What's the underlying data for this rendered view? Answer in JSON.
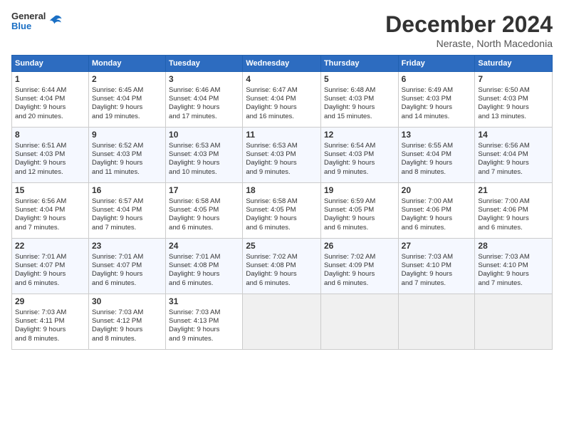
{
  "logo": {
    "general": "General",
    "blue": "Blue"
  },
  "header": {
    "month": "December 2024",
    "location": "Neraste, North Macedonia"
  },
  "weekdays": [
    "Sunday",
    "Monday",
    "Tuesday",
    "Wednesday",
    "Thursday",
    "Friday",
    "Saturday"
  ],
  "weeks": [
    [
      {
        "day": "1",
        "lines": [
          "Sunrise: 6:44 AM",
          "Sunset: 4:04 PM",
          "Daylight: 9 hours",
          "and 20 minutes."
        ]
      },
      {
        "day": "2",
        "lines": [
          "Sunrise: 6:45 AM",
          "Sunset: 4:04 PM",
          "Daylight: 9 hours",
          "and 19 minutes."
        ]
      },
      {
        "day": "3",
        "lines": [
          "Sunrise: 6:46 AM",
          "Sunset: 4:04 PM",
          "Daylight: 9 hours",
          "and 17 minutes."
        ]
      },
      {
        "day": "4",
        "lines": [
          "Sunrise: 6:47 AM",
          "Sunset: 4:04 PM",
          "Daylight: 9 hours",
          "and 16 minutes."
        ]
      },
      {
        "day": "5",
        "lines": [
          "Sunrise: 6:48 AM",
          "Sunset: 4:03 PM",
          "Daylight: 9 hours",
          "and 15 minutes."
        ]
      },
      {
        "day": "6",
        "lines": [
          "Sunrise: 6:49 AM",
          "Sunset: 4:03 PM",
          "Daylight: 9 hours",
          "and 14 minutes."
        ]
      },
      {
        "day": "7",
        "lines": [
          "Sunrise: 6:50 AM",
          "Sunset: 4:03 PM",
          "Daylight: 9 hours",
          "and 13 minutes."
        ]
      }
    ],
    [
      {
        "day": "8",
        "lines": [
          "Sunrise: 6:51 AM",
          "Sunset: 4:03 PM",
          "Daylight: 9 hours",
          "and 12 minutes."
        ]
      },
      {
        "day": "9",
        "lines": [
          "Sunrise: 6:52 AM",
          "Sunset: 4:03 PM",
          "Daylight: 9 hours",
          "and 11 minutes."
        ]
      },
      {
        "day": "10",
        "lines": [
          "Sunrise: 6:53 AM",
          "Sunset: 4:03 PM",
          "Daylight: 9 hours",
          "and 10 minutes."
        ]
      },
      {
        "day": "11",
        "lines": [
          "Sunrise: 6:53 AM",
          "Sunset: 4:03 PM",
          "Daylight: 9 hours",
          "and 9 minutes."
        ]
      },
      {
        "day": "12",
        "lines": [
          "Sunrise: 6:54 AM",
          "Sunset: 4:03 PM",
          "Daylight: 9 hours",
          "and 9 minutes."
        ]
      },
      {
        "day": "13",
        "lines": [
          "Sunrise: 6:55 AM",
          "Sunset: 4:04 PM",
          "Daylight: 9 hours",
          "and 8 minutes."
        ]
      },
      {
        "day": "14",
        "lines": [
          "Sunrise: 6:56 AM",
          "Sunset: 4:04 PM",
          "Daylight: 9 hours",
          "and 7 minutes."
        ]
      }
    ],
    [
      {
        "day": "15",
        "lines": [
          "Sunrise: 6:56 AM",
          "Sunset: 4:04 PM",
          "Daylight: 9 hours",
          "and 7 minutes."
        ]
      },
      {
        "day": "16",
        "lines": [
          "Sunrise: 6:57 AM",
          "Sunset: 4:04 PM",
          "Daylight: 9 hours",
          "and 7 minutes."
        ]
      },
      {
        "day": "17",
        "lines": [
          "Sunrise: 6:58 AM",
          "Sunset: 4:05 PM",
          "Daylight: 9 hours",
          "and 6 minutes."
        ]
      },
      {
        "day": "18",
        "lines": [
          "Sunrise: 6:58 AM",
          "Sunset: 4:05 PM",
          "Daylight: 9 hours",
          "and 6 minutes."
        ]
      },
      {
        "day": "19",
        "lines": [
          "Sunrise: 6:59 AM",
          "Sunset: 4:05 PM",
          "Daylight: 9 hours",
          "and 6 minutes."
        ]
      },
      {
        "day": "20",
        "lines": [
          "Sunrise: 7:00 AM",
          "Sunset: 4:06 PM",
          "Daylight: 9 hours",
          "and 6 minutes."
        ]
      },
      {
        "day": "21",
        "lines": [
          "Sunrise: 7:00 AM",
          "Sunset: 4:06 PM",
          "Daylight: 9 hours",
          "and 6 minutes."
        ]
      }
    ],
    [
      {
        "day": "22",
        "lines": [
          "Sunrise: 7:01 AM",
          "Sunset: 4:07 PM",
          "Daylight: 9 hours",
          "and 6 minutes."
        ]
      },
      {
        "day": "23",
        "lines": [
          "Sunrise: 7:01 AM",
          "Sunset: 4:07 PM",
          "Daylight: 9 hours",
          "and 6 minutes."
        ]
      },
      {
        "day": "24",
        "lines": [
          "Sunrise: 7:01 AM",
          "Sunset: 4:08 PM",
          "Daylight: 9 hours",
          "and 6 minutes."
        ]
      },
      {
        "day": "25",
        "lines": [
          "Sunrise: 7:02 AM",
          "Sunset: 4:08 PM",
          "Daylight: 9 hours",
          "and 6 minutes."
        ]
      },
      {
        "day": "26",
        "lines": [
          "Sunrise: 7:02 AM",
          "Sunset: 4:09 PM",
          "Daylight: 9 hours",
          "and 6 minutes."
        ]
      },
      {
        "day": "27",
        "lines": [
          "Sunrise: 7:03 AM",
          "Sunset: 4:10 PM",
          "Daylight: 9 hours",
          "and 7 minutes."
        ]
      },
      {
        "day": "28",
        "lines": [
          "Sunrise: 7:03 AM",
          "Sunset: 4:10 PM",
          "Daylight: 9 hours",
          "and 7 minutes."
        ]
      }
    ],
    [
      {
        "day": "29",
        "lines": [
          "Sunrise: 7:03 AM",
          "Sunset: 4:11 PM",
          "Daylight: 9 hours",
          "and 8 minutes."
        ]
      },
      {
        "day": "30",
        "lines": [
          "Sunrise: 7:03 AM",
          "Sunset: 4:12 PM",
          "Daylight: 9 hours",
          "and 8 minutes."
        ]
      },
      {
        "day": "31",
        "lines": [
          "Sunrise: 7:03 AM",
          "Sunset: 4:13 PM",
          "Daylight: 9 hours",
          "and 9 minutes."
        ]
      },
      null,
      null,
      null,
      null
    ]
  ]
}
